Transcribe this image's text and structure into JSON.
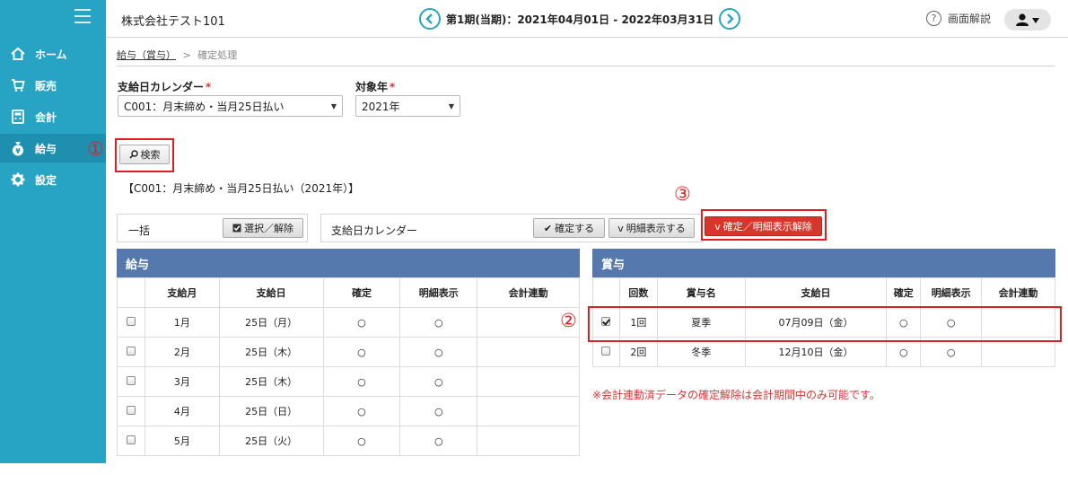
{
  "header": {
    "company": "株式会社テスト101",
    "period": "第1期(当期)：2021年04月01日 - 2022年03月31日",
    "help_label": "画面解説"
  },
  "sidebar": {
    "items": [
      {
        "label": "ホーム",
        "icon": "home-icon"
      },
      {
        "label": "販売",
        "icon": "cart-icon"
      },
      {
        "label": "会計",
        "icon": "calculator-icon"
      },
      {
        "label": "給与",
        "icon": "money-bag-icon"
      },
      {
        "label": "設定",
        "icon": "gear-icon"
      }
    ],
    "active_index": 3
  },
  "breadcrumb": {
    "parent": "給与（賞与）",
    "separator": ">",
    "current": "確定処理"
  },
  "form": {
    "calendar_label": "支給日カレンダー",
    "calendar_value": "C001：月末締め・当月25日払い",
    "year_label": "対象年",
    "year_value": "2021年",
    "required_mark": "*",
    "search_label": "検索"
  },
  "summary": "【C001：月末締め・当月25日払い（2021年）】",
  "bulk_bar": {
    "label": "一括",
    "select_button": "選択／解除"
  },
  "calendar_bar": {
    "label": "支給日カレンダー",
    "confirm_button": "確定する",
    "detail_button": "明細表示する",
    "unconfirm_button": "確定／明細表示解除"
  },
  "markers": {
    "one": "①",
    "two": "②",
    "three": "③"
  },
  "salary": {
    "title": "給与",
    "columns": [
      "",
      "支給月",
      "支給日",
      "確定",
      "明細表示",
      "会計連動"
    ],
    "rows": [
      {
        "month": "1月",
        "date": "25日（月）",
        "confirmed": "○",
        "detail": "○",
        "linked": ""
      },
      {
        "month": "2月",
        "date": "25日（木）",
        "confirmed": "○",
        "detail": "○",
        "linked": ""
      },
      {
        "month": "3月",
        "date": "25日（木）",
        "confirmed": "○",
        "detail": "○",
        "linked": ""
      },
      {
        "month": "4月",
        "date": "25日（日）",
        "confirmed": "○",
        "detail": "○",
        "linked": ""
      },
      {
        "month": "5月",
        "date": "25日（火）",
        "confirmed": "○",
        "detail": "○",
        "linked": ""
      }
    ]
  },
  "bonus": {
    "title": "賞与",
    "columns": [
      "",
      "回数",
      "賞与名",
      "支給日",
      "確定",
      "明細表示",
      "会計連動"
    ],
    "rows": [
      {
        "checked": true,
        "count": "1回",
        "name": "夏季",
        "date": "07月09日（金）",
        "confirmed": "○",
        "detail": "○",
        "linked": ""
      },
      {
        "checked": false,
        "count": "2回",
        "name": "冬季",
        "date": "12月10日（金）",
        "confirmed": "○",
        "detail": "○",
        "linked": ""
      }
    ]
  },
  "note": "※会計連動済データの確定解除は会計期間中のみ可能です。",
  "colors": {
    "sidebar": "#27a4c4",
    "panel_header": "#5578ad",
    "danger": "#d9352a",
    "annotation": "#e02020"
  }
}
